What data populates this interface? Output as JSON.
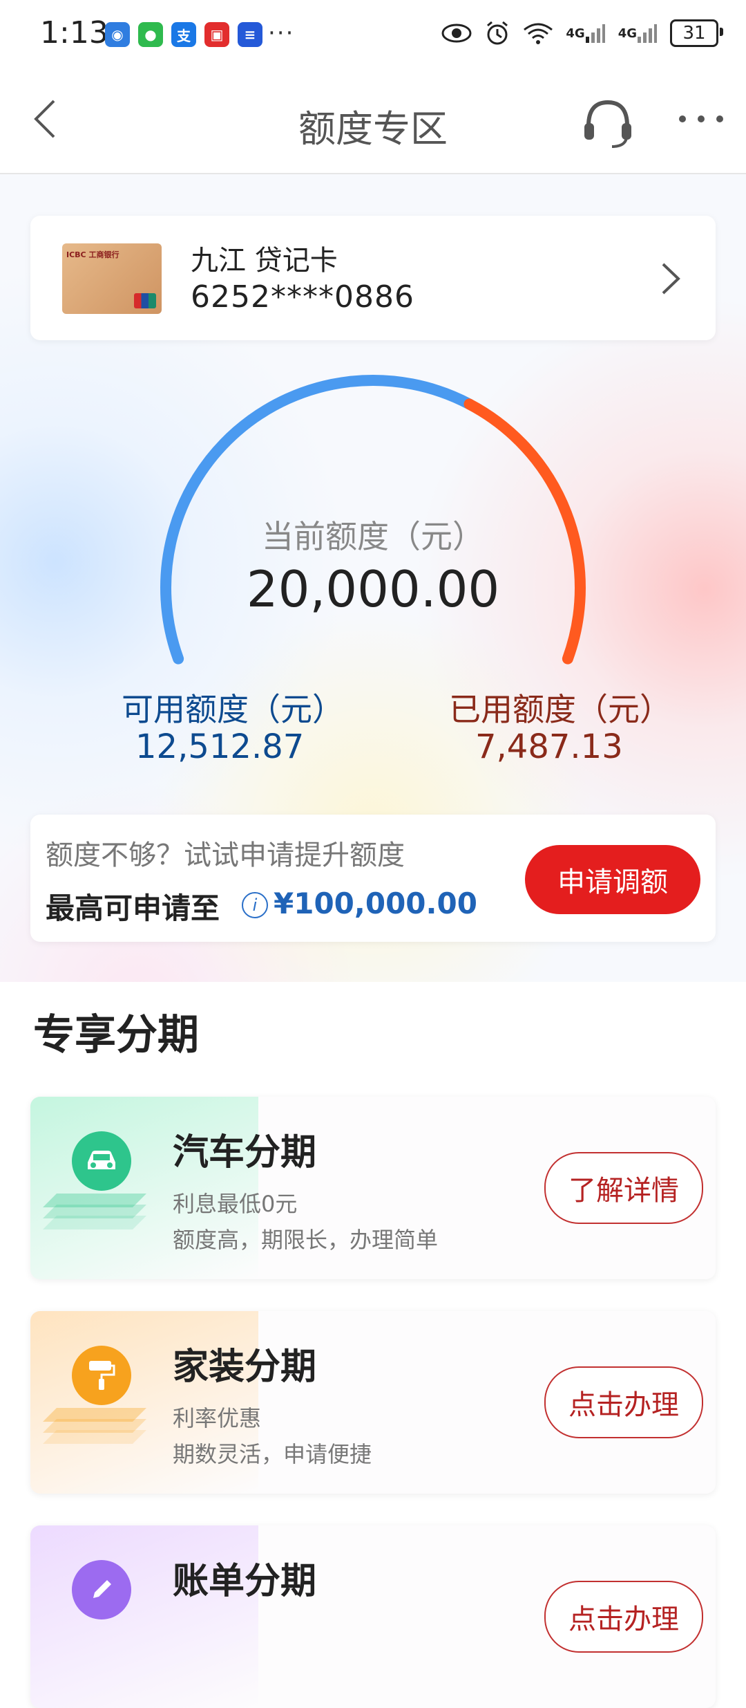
{
  "status_bar": {
    "time": "1:13",
    "more": "···",
    "battery": "31",
    "signal1": "4G",
    "signal2": "4G"
  },
  "nav": {
    "title": "额度专区"
  },
  "card": {
    "name": "九江 贷记卡",
    "number": "6252****0886",
    "bank_mark": "ICBC 中国工商银行"
  },
  "credit": {
    "current_label": "当前额度（元）",
    "current_value": "20,000.00",
    "available_label": "可用额度（元）",
    "available_value": "12,512.87",
    "used_label": "已用额度（元）",
    "used_value": "7,487.13",
    "used_fraction": 0.374
  },
  "boost": {
    "hint": "额度不够？试试申请提升额度",
    "max_label": "最高可申请至",
    "max_amount": "¥100,000.00",
    "apply_button": "申请调额"
  },
  "section": {
    "title": "专享分期"
  },
  "installments": [
    {
      "title": "汽车分期",
      "line1": "利息最低0元",
      "line2": "额度高，期限长，办理简单",
      "button": "了解详情",
      "icon": "car-icon",
      "color": "#2ec58c"
    },
    {
      "title": "家装分期",
      "line1": "利率优惠",
      "line2": "期数灵活，申请便捷",
      "button": "点击办理",
      "icon": "paint-roller-icon",
      "color": "#f7a21e"
    },
    {
      "title": "账单分期",
      "line1": "",
      "line2": "",
      "button": "点击办理",
      "icon": "pencil-icon",
      "color": "#9c6bf0"
    }
  ],
  "colors": {
    "available": "#4a9af0",
    "used": "#ff5a1f",
    "accent_red": "#e41e1e"
  }
}
